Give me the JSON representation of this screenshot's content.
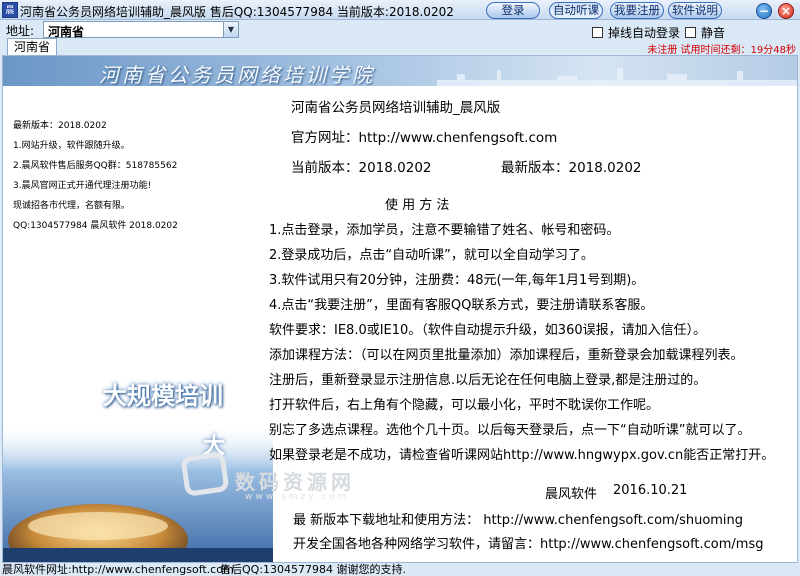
{
  "window": {
    "title": "河南省公务员网络培训辅助_晨风版 售后QQ:1304577984 当前版本:2018.0202",
    "icon_text": "晨"
  },
  "toolbar": {
    "login": "登录",
    "auto_listen": "自动听课",
    "register": "我要注册",
    "manual": "软件说明"
  },
  "address": {
    "label": "地址:",
    "value": "河南省"
  },
  "options": {
    "auto_relogin": "掉线自动登录",
    "mute": "静音"
  },
  "registration_status": "未注册 试用时间还剩：19分48秒",
  "tabs": [
    "河南省"
  ],
  "banner": {
    "title": "河南省公务员网络培训学院"
  },
  "news": [
    "最新版本：2018.0202",
    "1.网站升级，软件跟随升级。",
    "2.晨风软件售后服务QQ群：518785562",
    "3.晨风官网正式开通代理注册功能!",
    "  现诚招各市代理，名额有限。",
    "  QQ:1304577984   晨风软件 2018.0202"
  ],
  "decoration": {
    "text1": "大规模培训",
    "text2": "大"
  },
  "info": {
    "app_title": "河南省公务员网络培训辅助_晨风版",
    "website": "官方网址：http://www.chenfengsoft.com",
    "current_version": "当前版本：2018.0202",
    "latest_version": "最新版本：2018.0202",
    "usage_heading": "使 用 方 法",
    "steps": [
      "1.点击登录，添加学员，注意不要输错了姓名、帐号和密码。",
      "2.登录成功后，点击“自动听课”，就可以全自动学习了。",
      "3.软件试用只有20分钟，注册费：48元(一年,每年1月1号到期)。",
      "4.点击“我要注册”，里面有客服QQ联系方式，要注册请联系客服。"
    ],
    "notes": [
      "    软件要求：IE8.0或IE10。（软件自动提示升级，如360误报，请加入信任）。",
      "添加课程方法：（可以在网页里批量添加）添加课程后，重新登录会加载课程列表。",
      "注册后，重新登录显示注册信息.以后无论在任何电脑上登录,都是注册过的。",
      "打开软件后，右上角有个隐藏，可以最小化，平时不耽误你工作呢。",
      "别忘了多选点课程。选他个几十页。以后每天登录后，点一下“自动听课”就可以了。",
      "如果登录老是不成功，请检查省听课网站http://www.hngwypx.gov.cn能否正常打开。"
    ],
    "signature_name": "晨风软件",
    "signature_date": "2016.10.21",
    "download_line": "最 新版本下载地址和使用方法：  http://www.chenfengsoft.com/shuoming",
    "develop_line": "开发全国各地各种网络学习软件，请留言：http://www.chenfengsoft.com/msg"
  },
  "watermark": {
    "text": "数码资源网",
    "sub": "www.smzy.com"
  },
  "statusbar": {
    "website": "晨风软件网址:http://www.chenfengsoft.com",
    "support": "售后QQ:1304577984 谢谢您的支持."
  },
  "colors": {
    "accent": "#3d6fbf",
    "warning": "#d40000",
    "background": "#dbe8f6"
  }
}
